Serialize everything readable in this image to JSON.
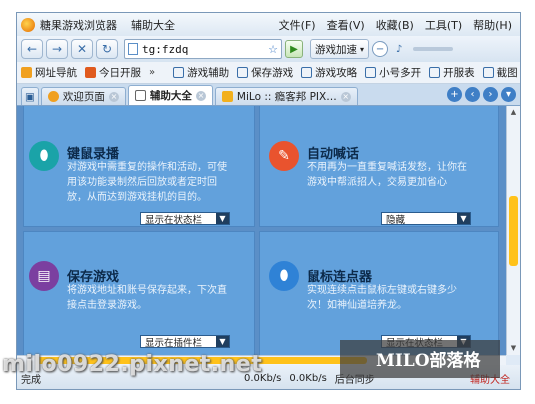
{
  "titlebar": {
    "app_name": "糖果游戏浏览器",
    "subtitle": "辅助大全",
    "menus": [
      "文件(F)",
      "查看(V)",
      "收藏(B)",
      "工具(T)",
      "帮助(H)"
    ]
  },
  "toolbar": {
    "address": "tg:fzdq",
    "accelerator": "游戏加速"
  },
  "favorites": {
    "left": [
      "网址导航",
      "今日开服"
    ],
    "more": "»",
    "right": [
      "游戏辅助",
      "保存游戏",
      "游戏攻略",
      "小号多开",
      "开服表",
      "截图"
    ]
  },
  "tabs": [
    {
      "label": "欢迎页面",
      "active": false
    },
    {
      "label": "辅助大全",
      "active": true
    },
    {
      "label": "MiLo :: 瘾客邦 PIX…",
      "active": false
    }
  ],
  "features": [
    {
      "icon": "mouse-icon",
      "title": "键鼠录播",
      "desc": [
        "对游戏中需重复的操作和活动，可使",
        "用该功能录制然后回放或者定时回",
        "放，从而达到游戏挂机的目的。"
      ],
      "select": "显示在状态栏",
      "color": "#1aa3a8"
    },
    {
      "icon": "megaphone-icon",
      "title": "自动喊话",
      "desc": [
        "不用再为一直重复喊话发愁，让你在",
        "游戏中帮派招人，交易更加省心"
      ],
      "select": "隐藏",
      "color": "#e9532e"
    },
    {
      "icon": "save-icon",
      "title": "保存游戏",
      "desc": [
        "将游戏地址和账号保存起来，下次直",
        "接点击登录游戏。"
      ],
      "select": "显示在插件栏",
      "color": "#7b3fa0"
    },
    {
      "icon": "click-icon",
      "title": "鼠标连点器",
      "desc": [
        "实现连续点击鼠标左键或右键多少",
        "次！如神仙道培养龙。"
      ],
      "select": "显示在状态栏",
      "color": "#2f82d6"
    }
  ],
  "statusbar": {
    "status": "完成",
    "down_speed": "0.0Kb/s",
    "up_speed": "0.0Kb/s",
    "bg_sync": "后台同步",
    "assist": "辅助大全"
  },
  "watermark": {
    "left": "milo0922.pixnet.net",
    "right": "MILO部落格"
  }
}
